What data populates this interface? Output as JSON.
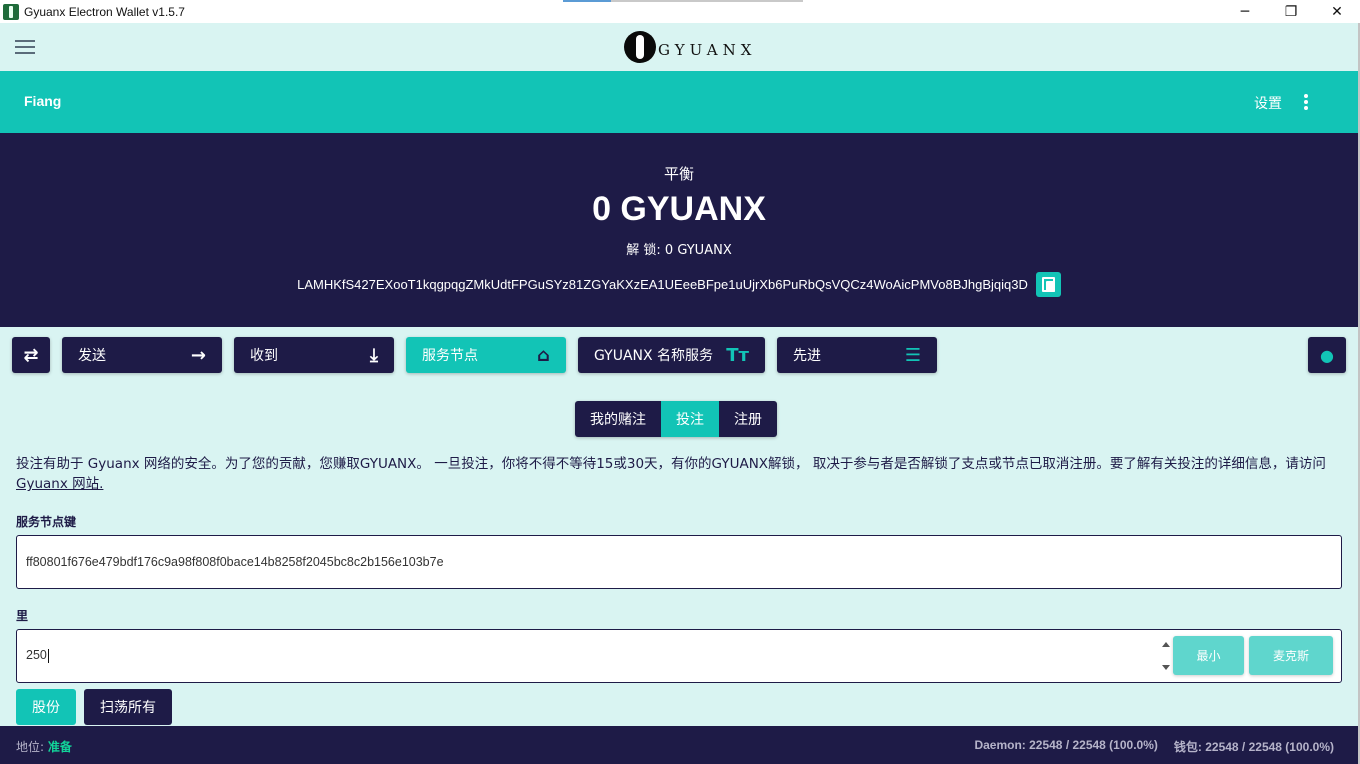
{
  "window": {
    "title": "Gyuanx Electron Wallet v1.5.7",
    "controls": {
      "minimize": "─",
      "restore": "❐",
      "close": "✕"
    }
  },
  "header": {
    "logo_text": "GYUANX",
    "menu_icon": "hamburger-icon"
  },
  "wallet_bar": {
    "wallet_name": "Fiang",
    "settings_label": "设置",
    "more_icon": "kebab-icon"
  },
  "balance": {
    "label": "平衡",
    "amount": "0 GYUANX",
    "unlocked": "解 锁: 0 GYUANX",
    "address": "LAMHKfS427EXooT1kqgpqgZMkUdtFPGuSYz81ZGYaKXzEA1UEeeBFpe1uUjrXb6PuRbQsVQCz4WoAicPMVo8BJhgBjqiq3D",
    "copy_icon": "copy-icon"
  },
  "nav": {
    "swap_icon": "⇄",
    "send": {
      "label": "发送",
      "icon": "→"
    },
    "receive": {
      "label": "收到",
      "icon": "⤓"
    },
    "service_node": {
      "label": "服务节点",
      "icon": "⌂"
    },
    "lns": {
      "label": "GYUANX 名称服务",
      "icon": "Tт"
    },
    "advanced": {
      "label": "先进",
      "icon": "☰"
    },
    "account_icon": "👤",
    "active": "service_node"
  },
  "tabs": [
    {
      "label": "我的赌注",
      "active": false
    },
    {
      "label": "投注",
      "active": true
    },
    {
      "label": "注册",
      "active": false
    }
  ],
  "description": {
    "text": "投注有助于 Gyuanx 网络的安全。为了您的贡献，您赚取GYUANX。 一旦投注，你将不得不等待15或30天，有你的GYUANX解锁， 取决于参与者是否解锁了支点或节点已取消注册。要了解有关投注的详细信息，请访问 ",
    "link_text": "Gyuanx 网站."
  },
  "form": {
    "service_node_key": {
      "label": "服务节点键",
      "value": "ff80801f676e479bdf176c9a98f808f0bace14b8258f2045bc8c2b156e103b7e"
    },
    "amount": {
      "label": "里",
      "value": "250",
      "min_label": "最小",
      "max_label": "麦克斯"
    },
    "stake_button": "股份",
    "sweep_button": "扫荡所有"
  },
  "status": {
    "position_label": "地位:",
    "position_value": "准备",
    "daemon": "Daemon: 22548 / 22548 (100.0%)",
    "wallet": "钱包: 22548 / 22548 (100.0%)"
  },
  "colors": {
    "navy": "#1e1b47",
    "teal": "#12c4b6",
    "teal_light": "#5fd6cd",
    "background": "#d9f4f2",
    "ready_green": "#12d39a"
  }
}
